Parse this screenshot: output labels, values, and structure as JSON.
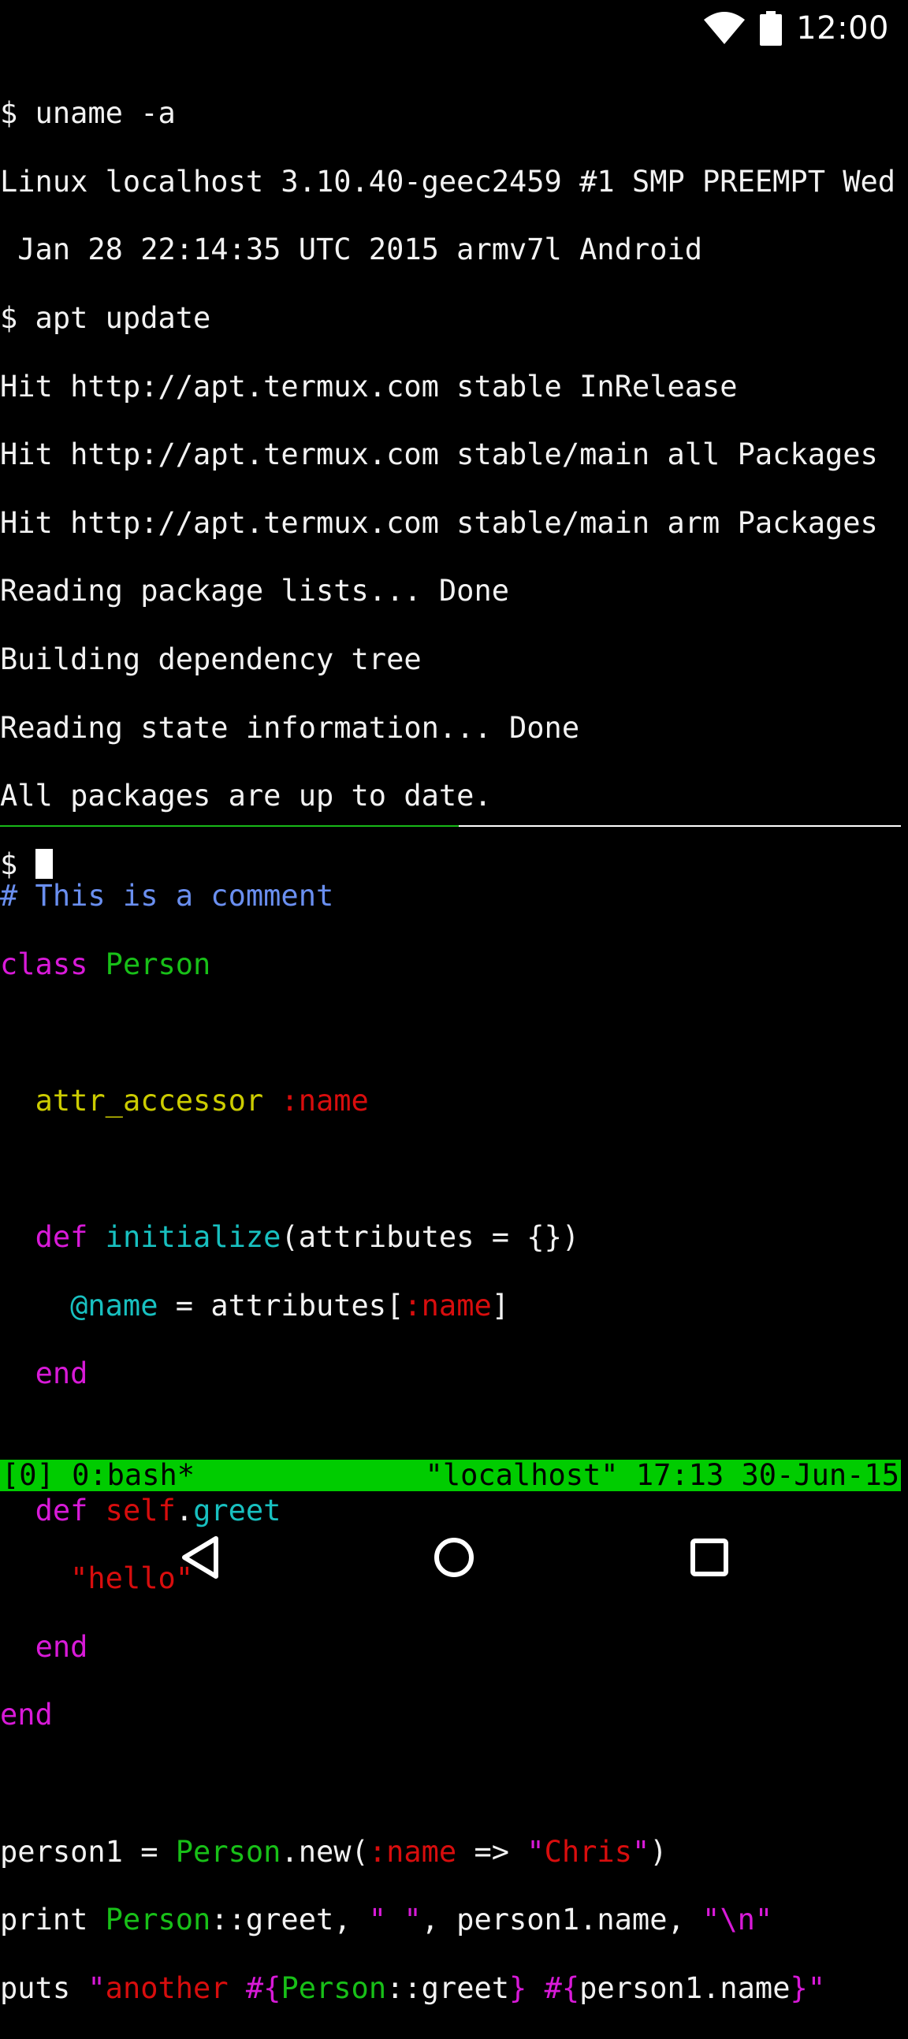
{
  "status_bar": {
    "time": "12:00",
    "icons": [
      "wifi-icon",
      "battery-icon"
    ]
  },
  "top_pane": {
    "lines": [
      "$ uname -a",
      "Linux localhost 3.10.40-geec2459 #1 SMP PREEMPT Wed",
      " Jan 28 22:14:35 UTC 2015 armv7l Android",
      "$ apt update",
      "Hit http://apt.termux.com stable InRelease",
      "Hit http://apt.termux.com stable/main all Packages",
      "Hit http://apt.termux.com stable/main arm Packages",
      "Reading package lists... Done",
      "Building dependency tree",
      "Reading state information... Done",
      "All packages are up to date."
    ],
    "prompt": "$ "
  },
  "code": {
    "l1": "# This is a comment",
    "l2_kw": "class",
    "l2_name": "Person",
    "l4_method": "attr_accessor",
    "l4_sym": ":name",
    "l6_kw": "def",
    "l6_fn": "initialize",
    "l6_rest": "(attributes = {})",
    "l7_ivar": "@name",
    "l7_mid": " = attributes[",
    "l7_sym": ":name",
    "l7_end": "]",
    "l8_kw": "end",
    "l10_kw": "def",
    "l10_self": "self",
    "l10_dot": ".",
    "l10_fn": "greet",
    "l11_str": "\"hello\"",
    "l12_kw": "end",
    "l13_kw": "end",
    "l15_a": "person1 = ",
    "l15_const": "Person",
    "l15_b": ".new(",
    "l15_sym": ":name",
    "l15_c": " => ",
    "l15_q1": "\"",
    "l15_str": "Chris",
    "l15_q2": "\"",
    "l15_d": ")",
    "l16_a": "print ",
    "l16_const": "Person",
    "l16_b": "::greet, ",
    "l16_str1": "\" \"",
    "l16_c": ", person1.name, ",
    "l16_str2": "\"\\n\"",
    "l17_a": "puts ",
    "l17_q1": "\"",
    "l17_str": "another ",
    "l17_interp1": "#{",
    "l17_const": "Person",
    "l17_b": "::greet",
    "l17_close1": "}",
    "l17_sp": " ",
    "l17_interp2": "#{",
    "l17_c": "person1.name",
    "l17_close2": "}",
    "l17_q2": "\""
  },
  "tmux": {
    "left": "[0] 0:bash*",
    "right": "\"localhost\" 17:13 30-Jun-15"
  },
  "colors": {
    "tmux_bar": "#00cc00",
    "active_pane_border": "#18b818"
  },
  "nav": {
    "buttons": [
      "back-icon",
      "home-icon",
      "recents-icon"
    ]
  }
}
